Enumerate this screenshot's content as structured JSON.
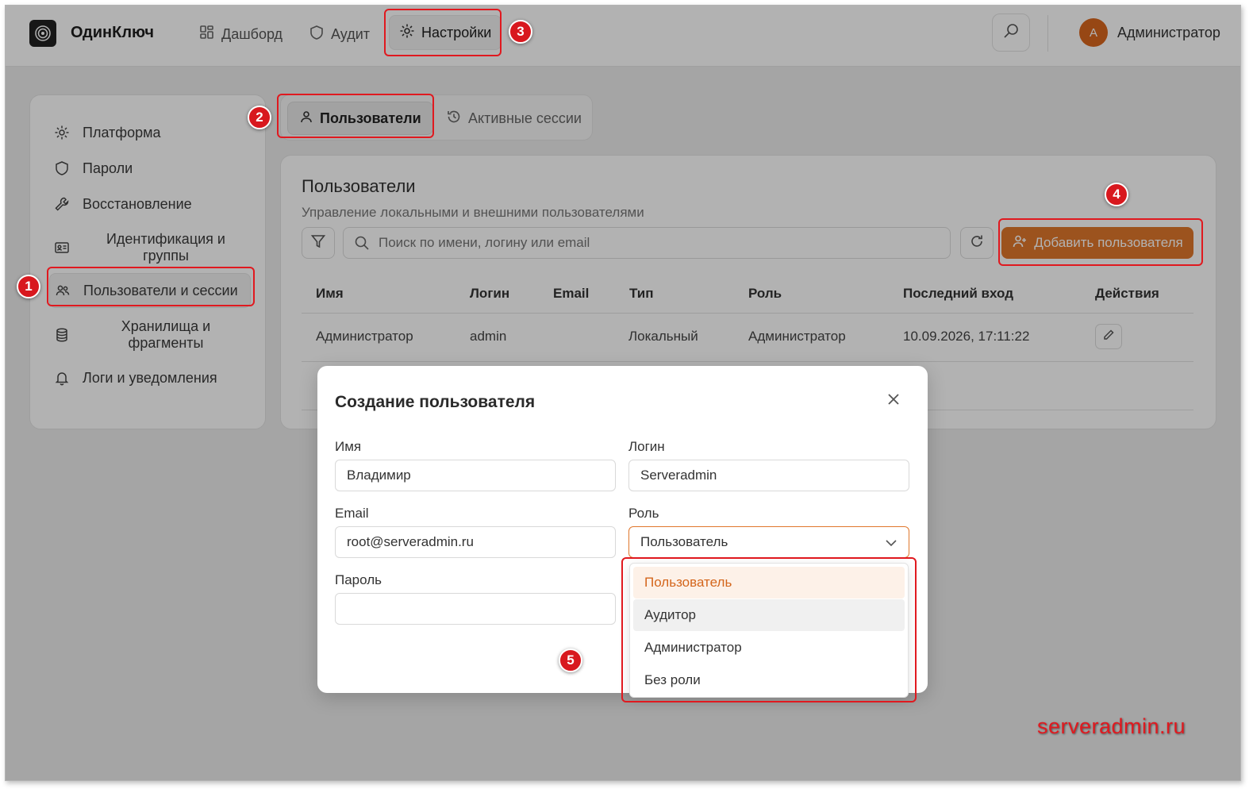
{
  "app": {
    "brand": "ОдинКлюч"
  },
  "nav": [
    {
      "label": "Дашборд",
      "icon": "dashboard-icon"
    },
    {
      "label": "Аудит",
      "icon": "shield-icon"
    },
    {
      "label": "Настройки",
      "icon": "gear-icon"
    }
  ],
  "header": {
    "user_initial": "А",
    "user_name": "Администратор"
  },
  "sidebar": {
    "items": [
      {
        "label": "Платформа",
        "icon": "gear-icon"
      },
      {
        "label": "Пароли",
        "icon": "shield-icon"
      },
      {
        "label": "Восстановление",
        "icon": "wrench-icon"
      },
      {
        "label": "Идентификация и группы",
        "icon": "id-card-icon"
      },
      {
        "label": "Пользователи и сессии",
        "icon": "users-icon"
      },
      {
        "label": "Хранилища и фрагменты",
        "icon": "database-icon"
      },
      {
        "label": "Логи и уведомления",
        "icon": "bell-icon"
      }
    ]
  },
  "tabs": [
    {
      "label": "Пользователи",
      "icon": "user-icon"
    },
    {
      "label": "Активные сессии",
      "icon": "history-icon"
    }
  ],
  "card": {
    "title": "Пользователи",
    "subtitle": "Управление локальными и внешними пользователями",
    "search_placeholder": "Поиск по имени, логину или email",
    "add_button": "Добавить пользователя"
  },
  "table": {
    "columns": [
      "Имя",
      "Логин",
      "Email",
      "Тип",
      "Роль",
      "Последний вход",
      "Действия"
    ],
    "rows": [
      {
        "name": "Администратор",
        "login": "admin",
        "email": "",
        "type": "Локальный",
        "role": "Администратор",
        "last_login": "10.09.2026, 17:11:22"
      }
    ]
  },
  "modal": {
    "title": "Создание пользователя",
    "fields": {
      "name_label": "Имя",
      "name_value": "Владимир",
      "login_label": "Логин",
      "login_value": "Serveradmin",
      "email_label": "Email",
      "email_value": "root@serveradmin.ru",
      "role_label": "Роль",
      "role_value": "Пользователь",
      "password_label": "Пароль",
      "password_value": ""
    },
    "role_options": [
      "Пользователь",
      "Аудитор",
      "Администратор",
      "Без роли"
    ]
  },
  "annotations": [
    "1",
    "2",
    "3",
    "4",
    "5"
  ],
  "watermark": "serveradmin.ru",
  "colors": {
    "accent": "#e0772c",
    "highlight": "#e0191f",
    "avatar": "#d9661d"
  }
}
